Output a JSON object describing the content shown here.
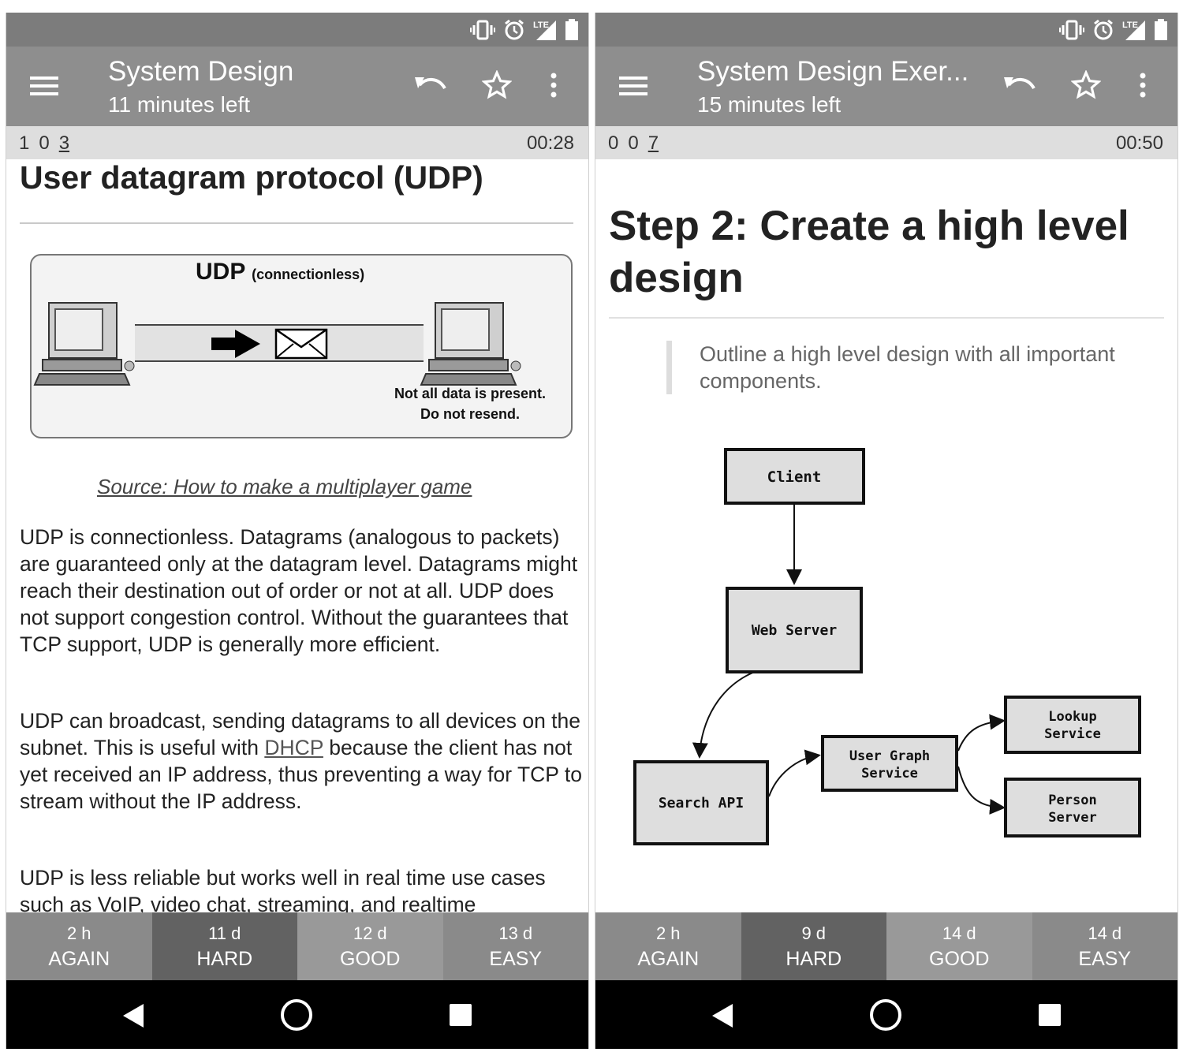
{
  "screens": [
    {
      "title": "System Design",
      "subtitle": "11 minutes left",
      "counts": {
        "new": "1",
        "learning": "0",
        "review": "3"
      },
      "timer": "00:28",
      "card": {
        "heading": "User datagram protocol (UDP)",
        "figure": {
          "title": "UDP",
          "subtitle": "(connectionless)",
          "note_line1": "Not all data is present.",
          "note_line2": "Do not resend."
        },
        "source_link": "Source: How to make a multiplayer game",
        "para1": "UDP is connectionless. Datagrams (analogous to packets) are guaranteed only at the datagram level. Datagrams might reach their destination out of order or not at all. UDP does not support congestion control. Without the guarantees that TCP support, UDP is generally more efficient.",
        "para2_before": "UDP can broadcast, sending datagrams to all devices on the subnet. This is useful with ",
        "para2_link": "DHCP",
        "para2_after": " because the client has not yet received an IP address, thus preventing a way for TCP to stream without the IP address.",
        "para3": "UDP is less reliable but works well in real time use cases such as VoIP, video chat, streaming, and realtime"
      },
      "answers": [
        {
          "interval": "2 h",
          "label": "AGAIN"
        },
        {
          "interval": "11 d",
          "label": "HARD"
        },
        {
          "interval": "12 d",
          "label": "GOOD"
        },
        {
          "interval": "13 d",
          "label": "EASY"
        }
      ]
    },
    {
      "title": "System Design Exer...",
      "subtitle": "15 minutes left",
      "counts": {
        "new": "0",
        "learning": "0",
        "review": "7"
      },
      "timer": "00:50",
      "card": {
        "heading": "Step 2: Create a high level design",
        "quote": "Outline a high level design with all important components.",
        "diagram": {
          "client": "Client",
          "web_server": "Web Server",
          "search_api": "Search API",
          "user_graph_line1": "User Graph",
          "user_graph_line2": "Service",
          "lookup_line1": "Lookup",
          "lookup_line2": "Service",
          "person_line1": "Person",
          "person_line2": "Server"
        }
      },
      "answers": [
        {
          "interval": "2 h",
          "label": "AGAIN"
        },
        {
          "interval": "9 d",
          "label": "HARD"
        },
        {
          "interval": "14 d",
          "label": "GOOD"
        },
        {
          "interval": "14 d",
          "label": "EASY"
        }
      ]
    }
  ],
  "colors": {
    "statusbar": "#7c7c7c",
    "toolbar": "#8e8e8e",
    "countbar": "#dedede",
    "btn_hard": "#626262",
    "btn_again_easy": "#8a8a8a",
    "btn_good": "#999999",
    "navbar": "#000000"
  },
  "icons": [
    "vibrate-icon",
    "alarm-icon",
    "lte-signal-icon",
    "battery-icon",
    "menu-icon",
    "undo-icon",
    "star-icon",
    "more-vert-icon",
    "nav-back-icon",
    "nav-home-icon",
    "nav-recents-icon"
  ]
}
